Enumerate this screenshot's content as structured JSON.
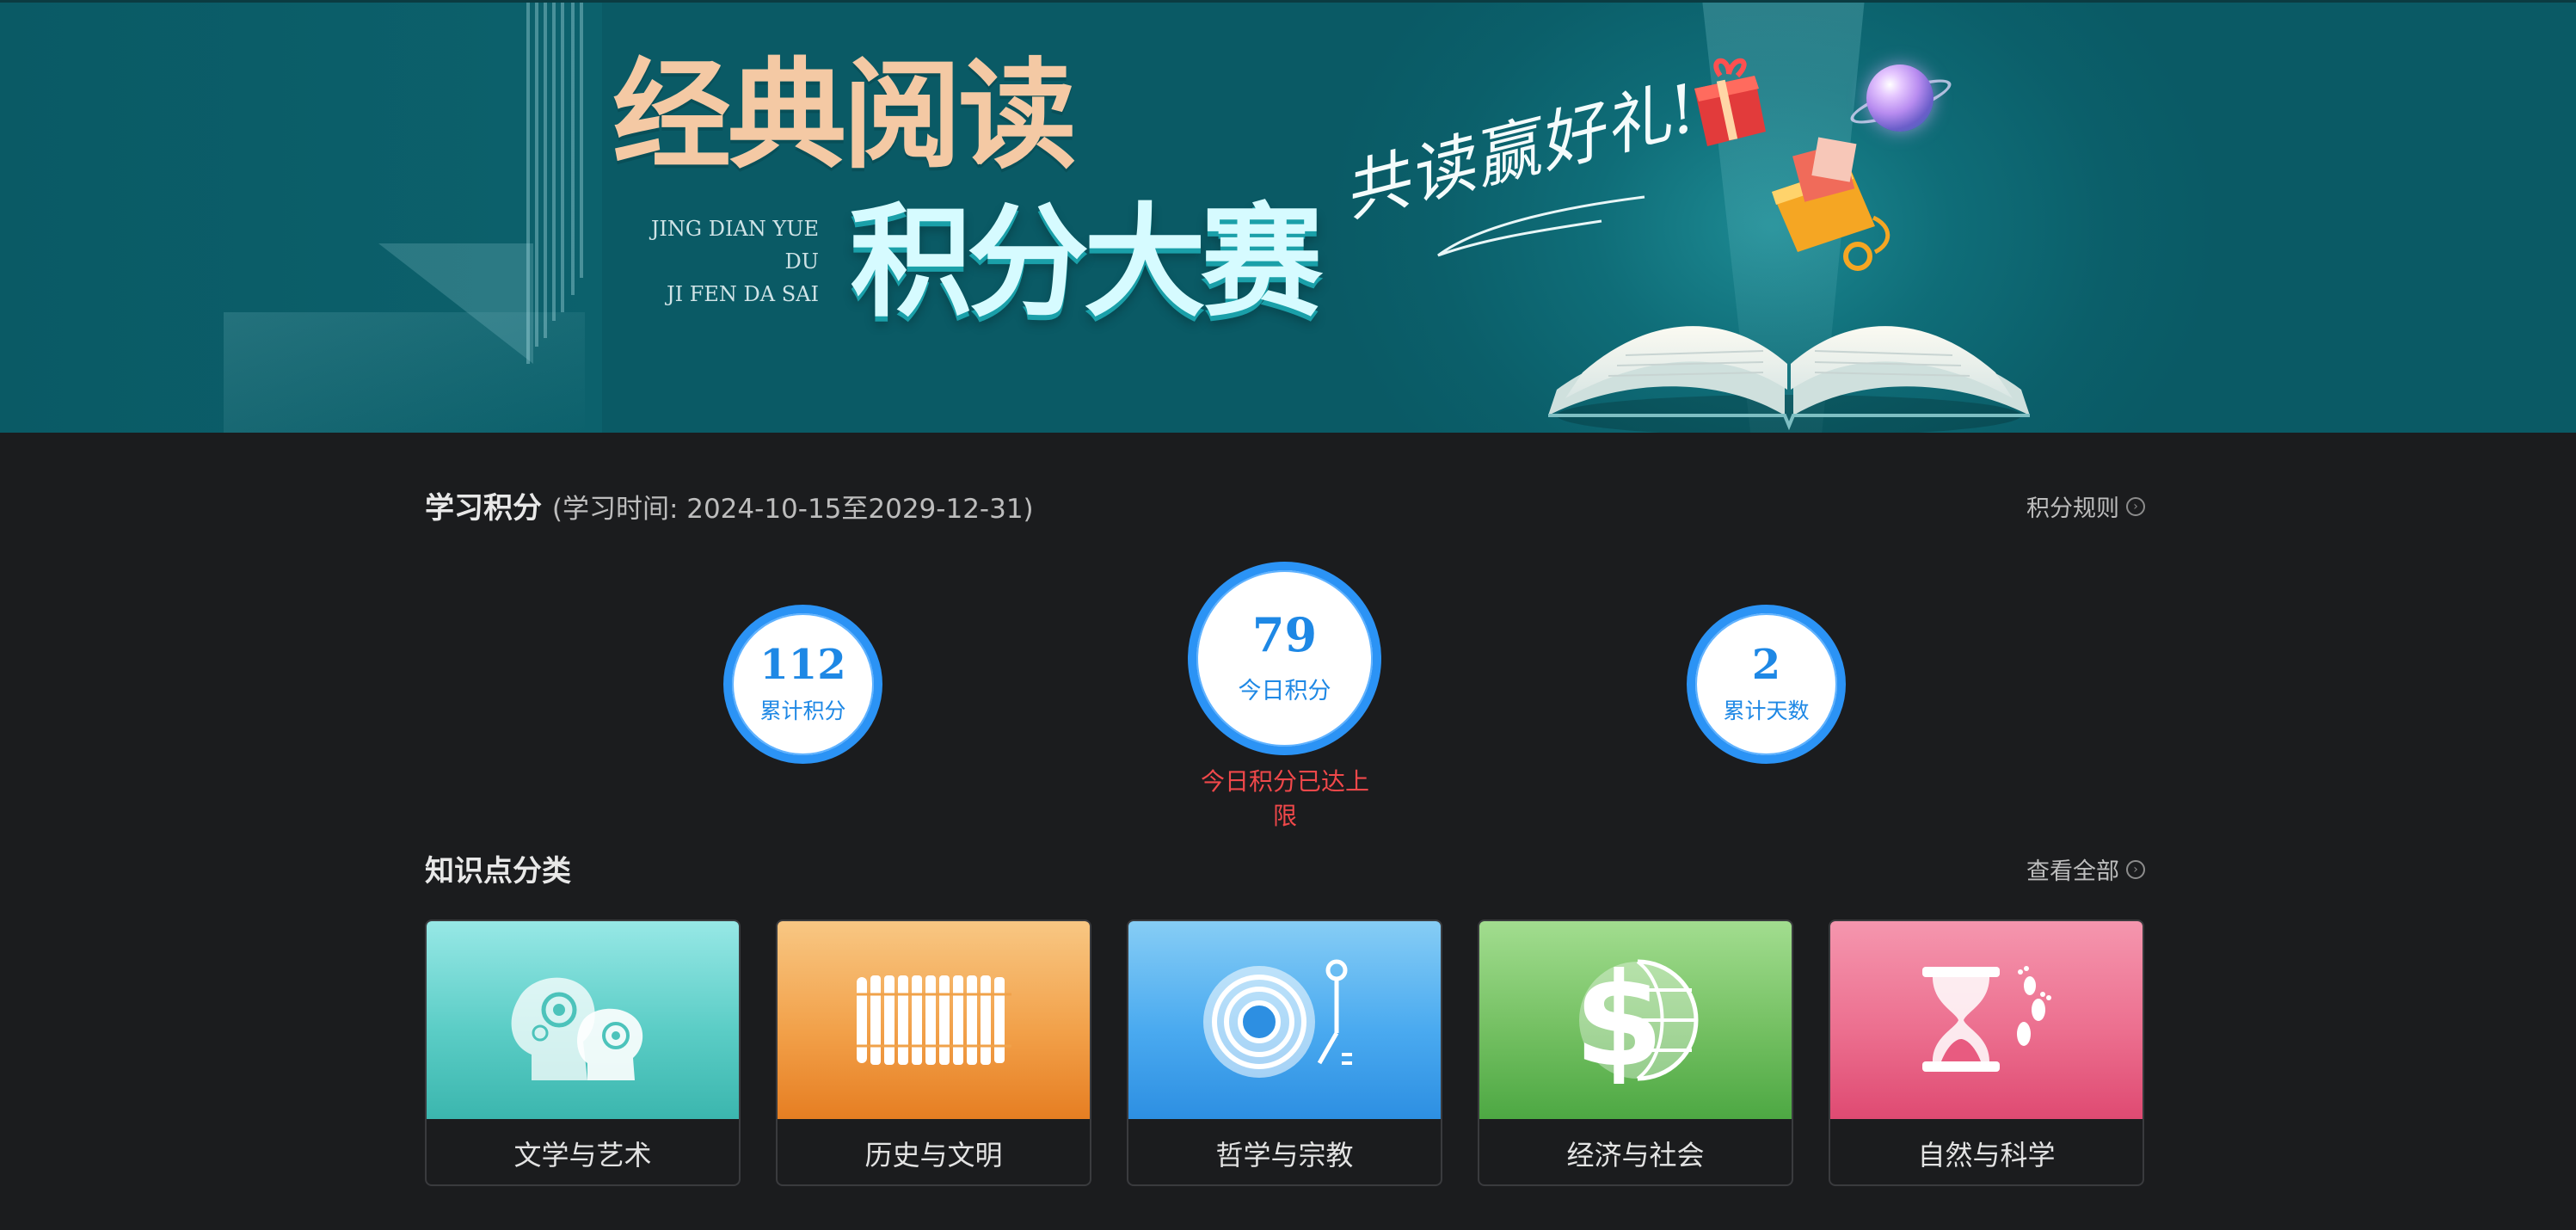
{
  "banner": {
    "title_line1": "经典阅读",
    "title_line2": "积分大赛",
    "pinyin_line1": "JING DIAN YUE DU",
    "pinyin_line2": "JI FEN DA SAI",
    "slogan": "共读赢好礼!"
  },
  "points": {
    "title": "学习积分",
    "period": "(学习时间: 2024-10-15至2029-12-31)",
    "rules_link": "积分规则",
    "stats": [
      {
        "value": "112",
        "label": "累计积分"
      },
      {
        "value": "79",
        "label": "今日积分"
      },
      {
        "value": "2",
        "label": "累计天数"
      }
    ],
    "limit_notice": "今日积分已达上限",
    "accent_color": "#2b93f5",
    "notice_color": "#f0484a"
  },
  "categories": {
    "title": "知识点分类",
    "view_all": "查看全部",
    "items": [
      {
        "label": "文学与艺术",
        "icon": "heads-icon",
        "color": "#4cc9c3"
      },
      {
        "label": "历史与文明",
        "icon": "bamboo-scroll-icon",
        "color": "#ef8f32"
      },
      {
        "label": "哲学与宗教",
        "icon": "record-player-icon",
        "color": "#3aa0ee"
      },
      {
        "label": "经济与社会",
        "icon": "dollar-globe-icon",
        "color": "#5cb85c"
      },
      {
        "label": "自然与科学",
        "icon": "hourglass-icon",
        "color": "#e85b80"
      }
    ]
  }
}
